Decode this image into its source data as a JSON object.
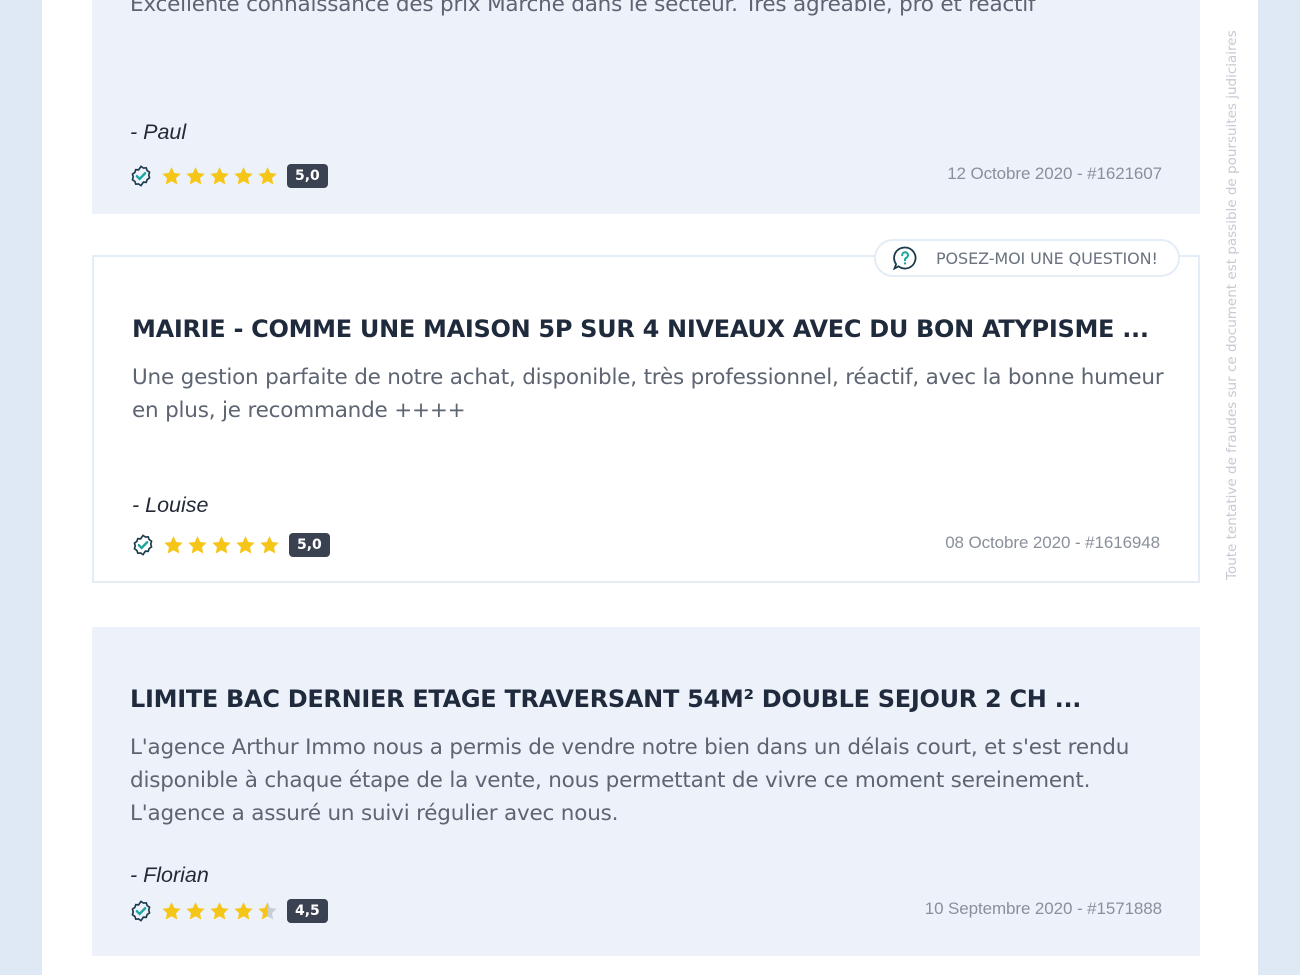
{
  "side_note": "Toute tentative de fraudes sur ce document est passible de poursuites judiciaires",
  "ask_button": {
    "label": "POSEZ-MOI UNE QUESTION!",
    "icon": "question-chat-icon"
  },
  "colors": {
    "star": "#f5c518",
    "star_empty": "#c9cdd4",
    "verified": "#1aa6a0",
    "badge": "#3a4150"
  },
  "reviews": [
    {
      "title": "",
      "text": "Excellente connaissance des prix Marché dans le secteur. Très agréable, pro et réactif",
      "author": "- Paul",
      "rating": 5.0,
      "score": "5,0",
      "meta": "12 Octobre 2020 - #1621607"
    },
    {
      "title": "MAIRIE - COMME UNE MAISON 5P SUR 4 NIVEAUX AVEC DU BON ATYPISME ...",
      "text": "Une gestion parfaite de notre achat, disponible, très professionnel, réactif, avec la bonne humeur en plus, je recommande ++++",
      "author": "- Louise",
      "rating": 5.0,
      "score": "5,0",
      "meta": "08 Octobre 2020 - #1616948"
    },
    {
      "title": "LIMITE BAC DERNIER ETAGE TRAVERSANT 54M² DOUBLE SEJOUR 2 CH ...",
      "text": "L'agence Arthur Immo nous a permis de vendre notre bien dans un délais court, et s'est rendu disponible à chaque étape de la vente, nous permettant de vivre ce moment sereinement. L'agence a assuré un suivi régulier avec nous.",
      "author": "- Florian",
      "rating": 4.5,
      "score": "4,5",
      "meta": "10 Septembre 2020 - #1571888"
    }
  ]
}
